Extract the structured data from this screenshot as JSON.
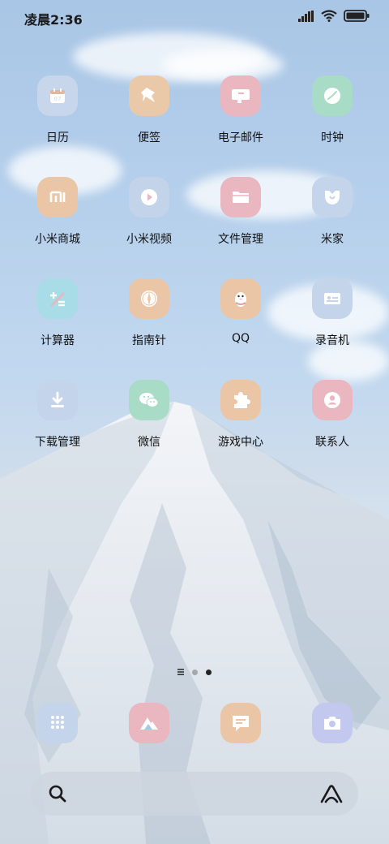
{
  "status_bar": {
    "time": "凌晨2:36",
    "icons": [
      "signal-icon",
      "wifi-icon",
      "battery-icon"
    ]
  },
  "apps": [
    {
      "id": "calendar",
      "label": "日历",
      "icon": "calendar-icon",
      "color": "#c8d6ec"
    },
    {
      "id": "notes",
      "label": "便签",
      "icon": "note-pin-icon",
      "color": "#e9c9a8"
    },
    {
      "id": "email",
      "label": "电子邮件",
      "icon": "mail-icon",
      "color": "#eab6bf"
    },
    {
      "id": "clock",
      "label": "时钟",
      "icon": "clock-icon",
      "color": "#a8dcc6"
    },
    {
      "id": "mi-store",
      "label": "小米商城",
      "icon": "mi-logo-icon",
      "color": "#eac6a6"
    },
    {
      "id": "mi-video",
      "label": "小米视频",
      "icon": "play-icon",
      "color": "#c3d3ea"
    },
    {
      "id": "files",
      "label": "文件管理",
      "icon": "folder-icon",
      "color": "#eab6bf"
    },
    {
      "id": "mi-home",
      "label": "米家",
      "icon": "mi-home-icon",
      "color": "#c4d4ea"
    },
    {
      "id": "calculator",
      "label": "计算器",
      "icon": "calculator-icon",
      "color": "#a8dce6"
    },
    {
      "id": "compass",
      "label": "指南针",
      "icon": "compass-icon",
      "color": "#eac6a6"
    },
    {
      "id": "qq",
      "label": "QQ",
      "icon": "penguin-icon",
      "color": "#eac6a6"
    },
    {
      "id": "recorder",
      "label": "录音机",
      "icon": "recorder-icon",
      "color": "#c4d4ea"
    },
    {
      "id": "downloads",
      "label": "下载管理",
      "icon": "download-icon",
      "color": "#c4d4ea"
    },
    {
      "id": "wechat",
      "label": "微信",
      "icon": "wechat-icon",
      "color": "#a8dcc6"
    },
    {
      "id": "game-center",
      "label": "游戏中心",
      "icon": "puzzle-icon",
      "color": "#eac6a6"
    },
    {
      "id": "contacts",
      "label": "联系人",
      "icon": "contact-icon",
      "color": "#eab6bf"
    }
  ],
  "page_indicator": {
    "pages": 3,
    "current": 3
  },
  "dock": [
    {
      "id": "phone",
      "icon": "dialpad-icon",
      "color": "#c4d4ea"
    },
    {
      "id": "gallery",
      "icon": "gallery-icon",
      "color": "#eab6bf"
    },
    {
      "id": "messages",
      "icon": "message-icon",
      "color": "#eac6a6"
    },
    {
      "id": "camera",
      "icon": "camera-icon",
      "color": "#c3c8ee"
    }
  ],
  "search_bar": {
    "left_icon": "search-icon",
    "right_icon": "assistant-icon"
  }
}
